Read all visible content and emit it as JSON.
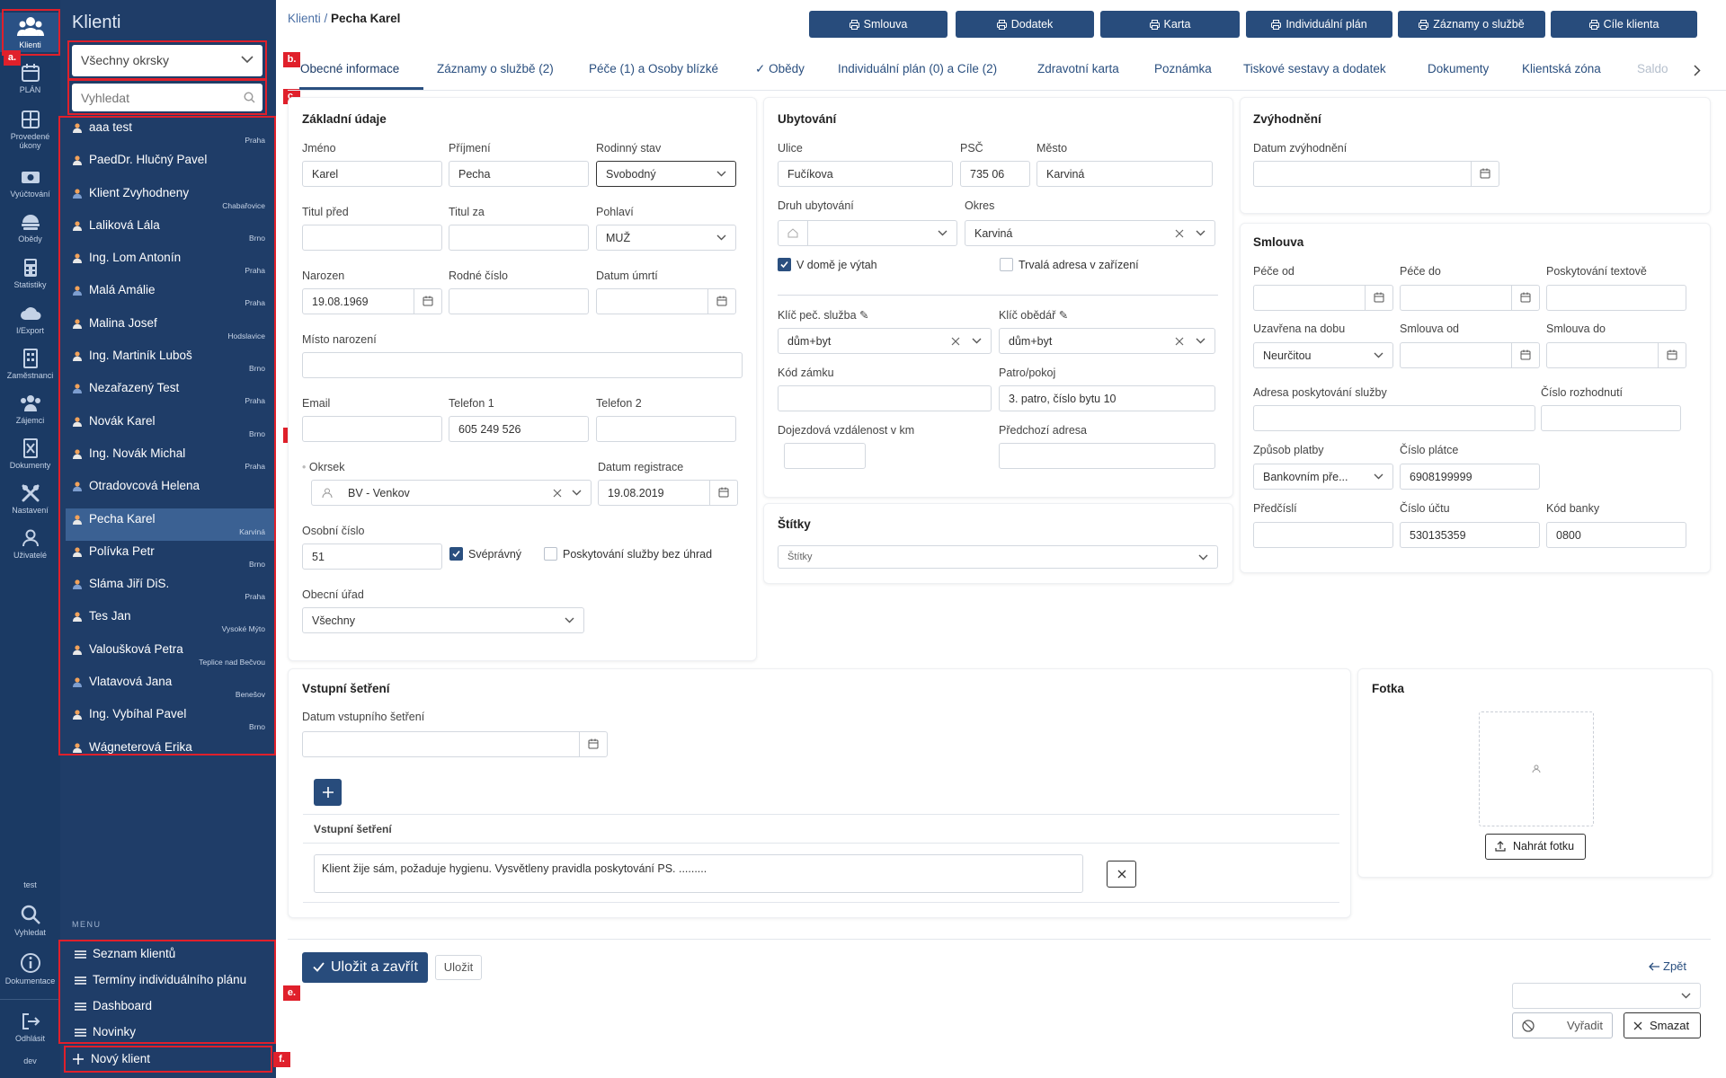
{
  "rail": {
    "items": [
      "Klienti",
      "PLÁN",
      "Provedené úkony",
      "Vyúčtování",
      "Obědy",
      "Statistiky",
      "I/Export",
      "Zaměstnanci",
      "Zájemci",
      "Dokumenty",
      "Nastavení",
      "Uživatelé"
    ],
    "bottom_user": "test",
    "search": "Vyhledat",
    "docs": "Dokumentace",
    "logout": "Odhlásit",
    "env": "dev"
  },
  "left_panel": {
    "title": "Klienti",
    "district_select": "Všechny okrsky",
    "search_placeholder": "Vyhledat",
    "clients": [
      {
        "name": "aaa test",
        "city": "Praha"
      },
      {
        "name": "PaedDr. Hlučný Pavel",
        "city": ""
      },
      {
        "name": "Klient Zvyhodneny",
        "city": "Chabařovice"
      },
      {
        "name": "Laliková Lála",
        "city": "Brno"
      },
      {
        "name": "Ing. Lom Antonín",
        "city": "Praha"
      },
      {
        "name": "Malá Amálie",
        "city": "Praha"
      },
      {
        "name": "Malina Josef",
        "city": "Hodslavice"
      },
      {
        "name": "Ing. Martiník Luboš",
        "city": "Brno"
      },
      {
        "name": "Nezařazený Test",
        "city": "Praha"
      },
      {
        "name": "Novák Karel",
        "city": "Brno"
      },
      {
        "name": "Ing. Novák Michal",
        "city": "Praha"
      },
      {
        "name": "Otradovcová Helena",
        "city": ""
      },
      {
        "name": "Pecha Karel",
        "city": "Karviná"
      },
      {
        "name": "Polívka Petr",
        "city": "Brno"
      },
      {
        "name": "Sláma Jiří DiS.",
        "city": "Praha"
      },
      {
        "name": "Tes Jan",
        "city": "Vysoké Mýto"
      },
      {
        "name": "Valoušková Petra",
        "city": "Teplice nad Bečvou"
      },
      {
        "name": "Vlatavová Jana",
        "city": "Benešov"
      },
      {
        "name": "Ing. Vybíhal Pavel",
        "city": "Brno"
      },
      {
        "name": "Wágneterová Erika",
        "city": ""
      }
    ],
    "menu_label": "MENU",
    "menu": [
      "Seznam klientů",
      "Termíny individuálního plánu",
      "Dashboard",
      "Novinky"
    ],
    "new_client": "Nový klient"
  },
  "annotations": [
    "a.",
    "b.",
    "c.",
    "d.",
    "e.",
    "f."
  ],
  "breadcrumb": {
    "root": "Klienti",
    "sep": " / ",
    "current": "Pecha Karel"
  },
  "top_buttons": [
    "Smlouva",
    "Dodatek",
    "Karta",
    "Individuální plán",
    "Záznamy o službě",
    "Cíle klienta"
  ],
  "tabs": [
    "Obecné informace",
    "Záznamy o službě (2)",
    "Péče (1) a Osoby blízké",
    "Obědy",
    "Individuální plán (0) a Cíle (2)",
    "Zdravotní karta",
    "Poznámka",
    "Tiskové sestavy a dodatek",
    "Dokumenty",
    "Klientská zóna",
    "Saldo"
  ],
  "basic": {
    "title": "Základní údaje",
    "jmeno_l": "Jméno",
    "jmeno": "Karel",
    "prijmeni_l": "Příjmení",
    "prijmeni": "Pecha",
    "stav_l": "Rodinný stav",
    "stav": "Svobodný",
    "titul_pred_l": "Titul před",
    "titul_za_l": "Titul za",
    "pohlavi_l": "Pohlaví",
    "pohlavi": "MUŽ",
    "narozen_l": "Narozen",
    "narozen": "19.08.1969",
    "rc_l": "Rodné číslo",
    "umrti_l": "Datum úmrtí",
    "misto_l": "Místo narození",
    "email_l": "Email",
    "tel1_l": "Telefon 1",
    "tel1": "605 249 526",
    "tel2_l": "Telefon 2",
    "okrsek_l": "Okrsek",
    "okrsek": "BV - Venkov",
    "registrace_l": "Datum registrace",
    "registrace": "19.08.2019",
    "osobni_l": "Osobní číslo",
    "osobni": "51",
    "svepravny": "Svéprávný",
    "bez_uhrad": "Poskytování služby bez úhrad",
    "urad_l": "Obecní úřad",
    "urad": "Všechny"
  },
  "lodging": {
    "title": "Ubytování",
    "ulice_l": "Ulice",
    "ulice": "Fučíkova",
    "psc_l": "PSČ",
    "psc": "735 06",
    "mesto_l": "Město",
    "mesto": "Karviná",
    "druh_l": "Druh ubytování",
    "okres_l": "Okres",
    "okres": "Karviná",
    "vytah": "V domě je výtah",
    "trvala": "Trvalá adresa v zařízení",
    "klic_ps_l": "Klíč peč. služba",
    "klic_ps": "dům+byt",
    "klic_ob_l": "Klíč obědář",
    "klic_ob": "dům+byt",
    "zamek_l": "Kód zámku",
    "patro_l": "Patro/pokoj",
    "patro": "3. patro, číslo bytu 10",
    "vzdalenost_l": "Dojezdová vzdálenost v km",
    "predchozi_l": "Předchozí adresa"
  },
  "labels_card": {
    "title": "Štítky",
    "placeholder": "Štítky"
  },
  "advantage": {
    "title": "Zvýhodnění",
    "datum_l": "Datum zvýhodnění"
  },
  "contract": {
    "title": "Smlouva",
    "pece_od_l": "Péče od",
    "pece_do_l": "Péče do",
    "text_l": "Poskytování textově",
    "uzavrena_l": "Uzavřena na dobu",
    "uzavrena": "Neurčitou",
    "smlouva_od_l": "Smlouva od",
    "smlouva_do_l": "Smlouva do",
    "adresa_l": "Adresa poskytování služby",
    "rozhodnuti_l": "Číslo rozhodnutí",
    "platba_l": "Způsob platby",
    "platba": "Bankovním pře...",
    "platce_l": "Číslo plátce",
    "platce": "6908199999",
    "predcisli_l": "Předčíslí",
    "ucet_l": "Číslo účtu",
    "ucet": "530135359",
    "banka_l": "Kód banky",
    "banka": "0800"
  },
  "entry": {
    "title": "Vstupní šetření",
    "datum_l": "Datum vstupního šetření",
    "sub_title": "Vstupní šetření",
    "text": "Klient žije sám, požaduje hygienu. Vysvětleny pravidla poskytování PS. ........."
  },
  "photo": {
    "title": "Fotka",
    "upload": "Nahrát fotku"
  },
  "footer": {
    "save_close": "Uložit a zavřít",
    "save": "Uložit",
    "back": "Zpět",
    "discard": "Vyřadit",
    "delete": "Smazat"
  }
}
